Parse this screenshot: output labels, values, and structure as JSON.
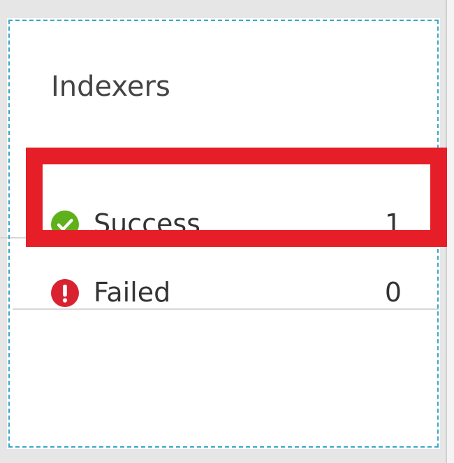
{
  "tile": {
    "title": "Indexers",
    "items": [
      {
        "label": "Success",
        "count": "1",
        "icon": "check-circle-icon",
        "color": "#5fb11b"
      },
      {
        "label": "Failed",
        "count": "0",
        "icon": "exclamation-circle-icon",
        "color": "#d9222f"
      }
    ]
  },
  "highlight": {
    "color": "#e51e27"
  }
}
